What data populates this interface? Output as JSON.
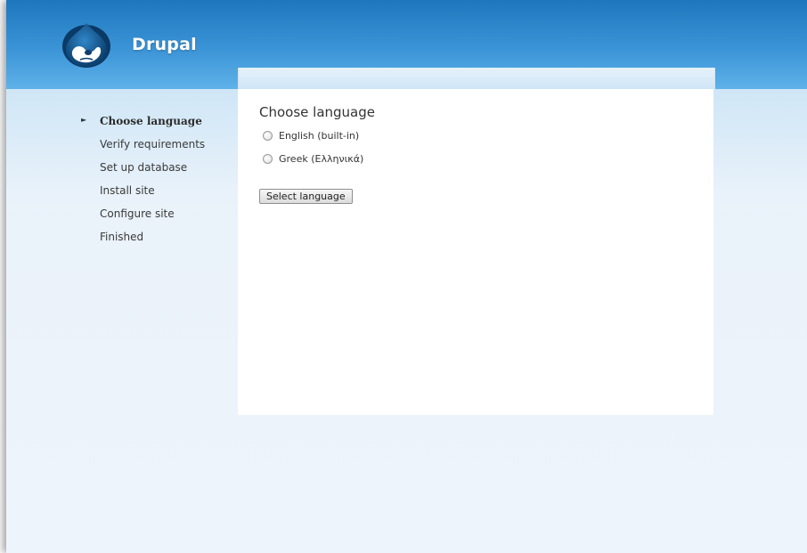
{
  "header": {
    "brand": "Drupal",
    "logo_icon": "drupal-drop-icon"
  },
  "sidebar": {
    "tasks": [
      {
        "label": "Choose language",
        "active": true
      },
      {
        "label": "Verify requirements",
        "active": false
      },
      {
        "label": "Set up database",
        "active": false
      },
      {
        "label": "Install site",
        "active": false
      },
      {
        "label": "Configure site",
        "active": false
      },
      {
        "label": "Finished",
        "active": false
      }
    ],
    "active_marker_icon": "triangle-right-icon"
  },
  "main": {
    "title": "Choose language",
    "options": [
      {
        "label": "English (built-in)",
        "selected": false
      },
      {
        "label": "Greek (Ελληνικά)",
        "selected": false
      }
    ],
    "submit_label": "Select language"
  },
  "colors": {
    "header_top": "#1e77bd",
    "header_bottom": "#5fb2e9",
    "page_bg": "#eef4fb"
  }
}
